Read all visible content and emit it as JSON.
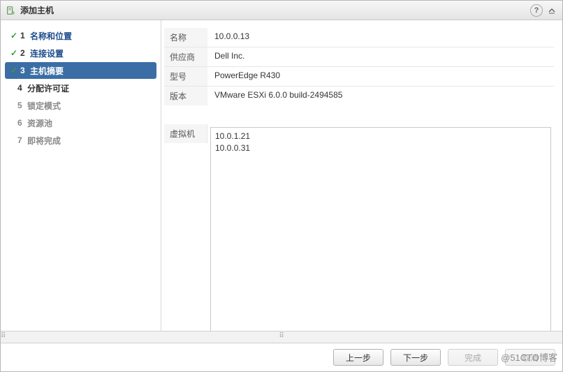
{
  "title": "添加主机",
  "steps": [
    {
      "num": "1",
      "label": "名称和位置",
      "state": "completed"
    },
    {
      "num": "2",
      "label": "连接设置",
      "state": "completed"
    },
    {
      "num": "3",
      "label": "主机摘要",
      "state": "current"
    },
    {
      "num": "4",
      "label": "分配许可证",
      "state": "pending"
    },
    {
      "num": "5",
      "label": "锁定模式",
      "state": "disabled"
    },
    {
      "num": "6",
      "label": "资源池",
      "state": "disabled"
    },
    {
      "num": "7",
      "label": "即将完成",
      "state": "disabled"
    }
  ],
  "summary": {
    "name_label": "名称",
    "name_value": "10.0.0.13",
    "vendor_label": "供应商",
    "vendor_value": "Dell Inc.",
    "model_label": "型号",
    "model_value": "PowerEdge R430",
    "version_label": "版本",
    "version_value": "VMware ESXi 6.0.0 build-2494585",
    "vm_label": "虚拟机",
    "vms": [
      "10.0.1.21",
      "10.0.0.31"
    ]
  },
  "buttons": {
    "back": "上一步",
    "next": "下一步",
    "finish": "完成",
    "cancel": "取消"
  },
  "watermark": "@51CTO博客",
  "icons": {
    "host": "host-icon",
    "help": "help-icon",
    "collapse": "collapse-icon",
    "check": "check-icon"
  }
}
